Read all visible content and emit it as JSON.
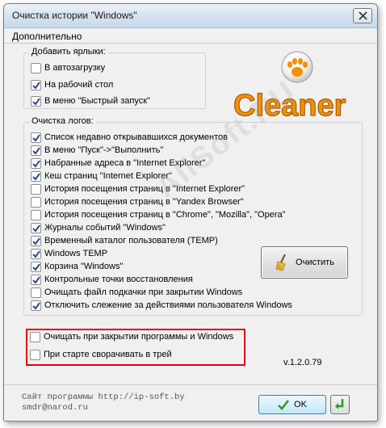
{
  "window": {
    "title": "Очистка истории \"Windows\""
  },
  "menu": {
    "items": [
      {
        "label": "Дополнительно"
      }
    ]
  },
  "shortcuts": {
    "title": "Добавить ярлыки:",
    "items": [
      {
        "label": "В автозагрузку",
        "checked": false
      },
      {
        "label": "На рабочий стол",
        "checked": true
      },
      {
        "label": "В меню \"Быстрый запуск\"",
        "checked": true
      }
    ]
  },
  "logo": {
    "text": "Cleaner"
  },
  "logs": {
    "title": "Очистка логов:",
    "items": [
      {
        "label": "Список недавно открывавшихся документов",
        "checked": true
      },
      {
        "label": "В меню \"Пуск\"->\"Выполнить\"",
        "checked": true
      },
      {
        "label": "Набранные адреса в \"Internet Explorer\"",
        "checked": true
      },
      {
        "label": "Кеш страниц \"Internet Explorer\"",
        "checked": true
      },
      {
        "label": "История посещения страниц в \"Internet Explorer\"",
        "checked": false
      },
      {
        "label": "История посещения страниц в \"Yandex Browser\"",
        "checked": false
      },
      {
        "label": "История посещения страниц в \"Chrome\", \"Mozilla\", \"Opera\"",
        "checked": false
      },
      {
        "label": "Журналы событий \"Windows\"",
        "checked": true
      },
      {
        "label": "Временный каталог пользователя (TEMP)",
        "checked": true
      },
      {
        "label": "Windows TEMP",
        "checked": true
      },
      {
        "label": "Корзина \"Windows\"",
        "checked": true
      },
      {
        "label": "Контрольные точки восстановления",
        "checked": true
      },
      {
        "label": "Очищать файл подкачки при закрытии Windows",
        "checked": false
      },
      {
        "label": "Отключить слежение за действиями пользователя Windows",
        "checked": true
      }
    ],
    "clean_button": "Очистить"
  },
  "options": {
    "items": [
      {
        "label": "Очищать при закрытии программы и Windows",
        "checked": false
      },
      {
        "label": "При старте сворачивать в трей",
        "checked": false
      }
    ]
  },
  "version": "v.1.2.0.79",
  "footer": {
    "site_line1": "Сайт программы http://ip-soft.by",
    "site_line2": "smdr@narod.ru",
    "ok_label": "OK"
  },
  "watermark": "AllSoft.RU",
  "colors": {
    "accent_red": "#e2001a",
    "logo_orange": "#f29200",
    "check_blue": "#2a4a8a"
  }
}
